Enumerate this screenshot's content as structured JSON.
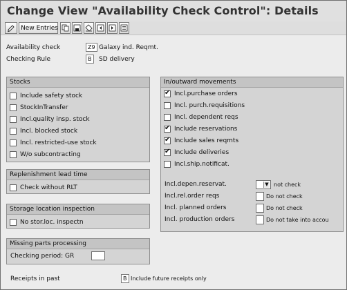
{
  "title": "Change View \"Availability Check Control\": Details",
  "toolbar": {
    "new_entries_label": "New Entries",
    "icons": [
      "change-display-icon",
      "copy-icon",
      "save-icon",
      "delete-icon",
      "previous-entry-icon",
      "next-entry-icon",
      "variable-list-icon"
    ]
  },
  "header": {
    "availability_check_label": "Availability check",
    "availability_check_value": "Z9",
    "availability_check_desc": "Galaxy ind. Reqmt.",
    "checking_rule_label": "Checking Rule",
    "checking_rule_value": "B",
    "checking_rule_desc": "SD delivery"
  },
  "stocks": {
    "title": "Stocks",
    "items": [
      {
        "label": "Include safety stock",
        "checked": false
      },
      {
        "label": "StockInTransfer",
        "checked": false
      },
      {
        "label": "Incl.quality insp. stock",
        "checked": false
      },
      {
        "label": "Incl. blocked stock",
        "checked": false
      },
      {
        "label": "Incl. restricted-use stock",
        "checked": false
      },
      {
        "label": "W/o subcontracting",
        "checked": false
      }
    ]
  },
  "replenishment": {
    "title": "Replenishment lead time",
    "items": [
      {
        "label": "Check without RLT",
        "checked": false
      }
    ]
  },
  "storage": {
    "title": "Storage location inspection",
    "items": [
      {
        "label": "No stor.loc. inspectn",
        "checked": false
      }
    ]
  },
  "missing_parts": {
    "title": "Missing parts processing",
    "checking_period_label": "Checking period: GR",
    "checking_period_value": ""
  },
  "movements": {
    "title": "In/outward movements",
    "items": [
      {
        "label": "Incl.purchase orders",
        "checked": true
      },
      {
        "label": "Incl. purch.requisitions",
        "checked": false
      },
      {
        "label": "Incl. dependent reqs",
        "checked": false
      },
      {
        "label": "Include reservations",
        "checked": true
      },
      {
        "label": "Include sales reqmts",
        "checked": true
      },
      {
        "label": "Include deliveries",
        "checked": true
      },
      {
        "label": "Incl.ship.notificat.",
        "checked": false
      }
    ],
    "selects": [
      {
        "label": "Incl.depen.reservat.",
        "value": "",
        "text": "not check"
      },
      {
        "label": "Incl.rel.order reqs",
        "value": "",
        "text": "Do not check"
      },
      {
        "label": "Incl. planned orders",
        "value": "",
        "text": "Do not check"
      },
      {
        "label": "Incl. production orders",
        "value": "",
        "text": "Do not take into accou"
      }
    ]
  },
  "receipts": {
    "label": "Receipts in past",
    "value": "B",
    "desc": "Include future receipts only"
  },
  "colors": {
    "group_bg": "#d4d4d4",
    "group_head_bg": "#c4c4c4",
    "page_bg": "#ececec"
  }
}
